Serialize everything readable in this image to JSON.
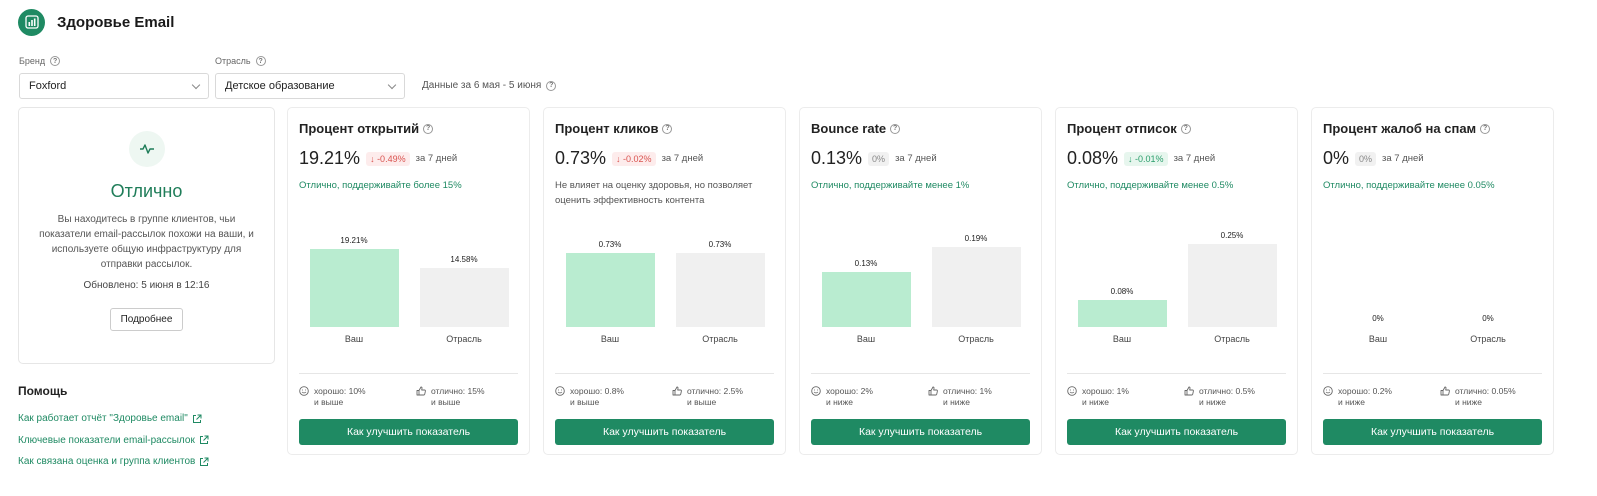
{
  "app": {
    "title": "Здоровье Email"
  },
  "filters": {
    "brand_label": "Бренд",
    "brand_value": "Foxford",
    "industry_label": "Отрасль",
    "industry_value": "Детское образование",
    "data_range": "Данные за 6 мая - 5 июня"
  },
  "health": {
    "status": "Отлично",
    "description": "Вы находитесь в группе клиентов, чьи показатели email-рассылок похожи на ваши, и используете общую инфраструктуру для отправки рассылок.",
    "updated": "Обновлено: 5 июня в 12:16",
    "more_button": "Подробнее"
  },
  "help": {
    "title": "Помощь",
    "links": [
      "Как работает отчёт \"Здоровье email\"",
      "Ключевые показатели email-рассылок",
      "Как связана оценка и группа клиентов"
    ]
  },
  "colors": {
    "brand": "#1f8a63",
    "yours_bar": "#b9ecd0",
    "industry_bar": "#f0f0f0",
    "negative": "#d9534f",
    "positive": "#2a9d6b"
  },
  "labels": {
    "yours": "Ваш",
    "industry": "Отрасль",
    "period": "за 7 дней"
  },
  "metrics": [
    {
      "title": "Процент открытий",
      "value": "19.21%",
      "delta": "↓ -0.49%",
      "delta_tone": "red",
      "note": "Отлично, поддерживайте более 15%",
      "note_tone": "green",
      "yours": 19.21,
      "yours_label": "19.21%",
      "industry": 14.58,
      "industry_label": "14.58%",
      "scale_max": 24.56,
      "good_label": "хорошо: 10%",
      "good_sub": "и выше",
      "great_label": "отлично: 15%",
      "great_sub": "и выше",
      "button": "Как улучшить показатель"
    },
    {
      "title": "Процент кликов",
      "value": "0.73%",
      "delta": "↓ -0.02%",
      "delta_tone": "red",
      "note": "Не влияет на оценку здоровья, но позволяет оценить эффективность контента",
      "note_tone": "grey",
      "yours": 0.73,
      "yours_label": "0.73%",
      "industry": 0.73,
      "industry_label": "0.73%",
      "scale_max": 0.98,
      "good_label": "хорошо: 0.8%",
      "good_sub": "и выше",
      "great_label": "отлично: 2.5%",
      "great_sub": "и выше",
      "button": "Как улучшить показатель"
    },
    {
      "title": "Bounce rate",
      "value": "0.13%",
      "delta": "0%",
      "delta_tone": "grey",
      "note": "Отлично, поддерживайте менее 1%",
      "note_tone": "green",
      "yours": 0.13,
      "yours_label": "0.13%",
      "industry": 0.19,
      "industry_label": "0.19%",
      "scale_max": 0.2375,
      "good_label": "хорошо: 2%",
      "good_sub": "и ниже",
      "great_label": "отлично: 1%",
      "great_sub": "и ниже",
      "button": "Как улучшить показатель"
    },
    {
      "title": "Процент отписок",
      "value": "0.08%",
      "delta": "↓ -0.01%",
      "delta_tone": "green",
      "note": "Отлично, поддерживайте менее 0.5%",
      "note_tone": "green",
      "yours": 0.08,
      "yours_label": "0.08%",
      "industry": 0.25,
      "industry_label": "0.25%",
      "scale_max": 0.3,
      "good_label": "хорошо: 1%",
      "good_sub": "и ниже",
      "great_label": "отлично: 0.5%",
      "great_sub": "и ниже",
      "button": "Как улучшить показатель"
    },
    {
      "title": "Процент жалоб на спам",
      "value": "0%",
      "delta": "0%",
      "delta_tone": "grey",
      "note": "Отлично, поддерживайте менее 0.05%",
      "note_tone": "green",
      "yours": 0,
      "yours_label": "0%",
      "industry": 0,
      "industry_label": "0%",
      "scale_max": 1,
      "good_label": "хорошо: 0.2%",
      "good_sub": "и ниже",
      "great_label": "отлично: 0.05%",
      "great_sub": "и ниже",
      "button": "Как улучшить показатель"
    }
  ]
}
